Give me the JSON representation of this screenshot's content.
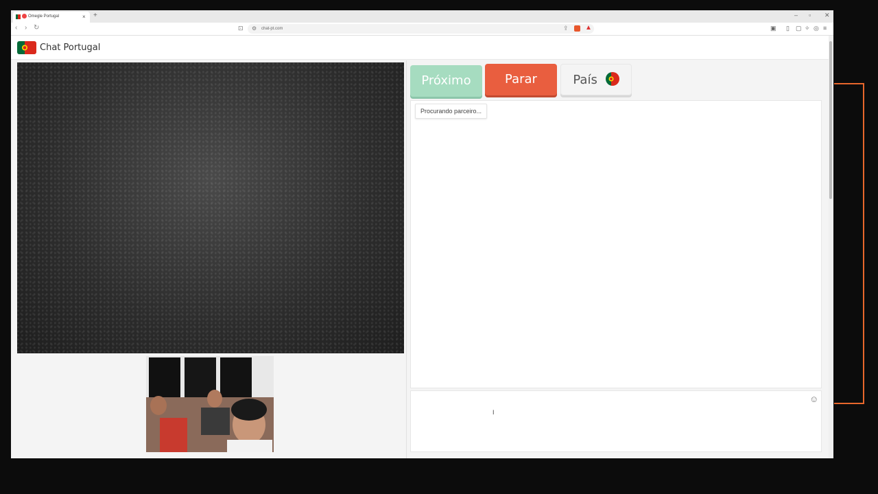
{
  "browser": {
    "tab_title": "Omegle Portugal",
    "tab_close": "×",
    "new_tab": "+",
    "window_controls": [
      "–",
      "▫",
      "✕"
    ],
    "url": "chat-pt.com",
    "nav_back": "‹",
    "nav_forward": "›",
    "reload": "↻"
  },
  "site": {
    "title": "Chat Portugal"
  },
  "controls": {
    "next_label": "Próximo",
    "stop_label": "Parar",
    "country_label": "País"
  },
  "chat": {
    "status": "Procurando parceiro...",
    "input_value": ""
  },
  "colors": {
    "next": "#a6dcc0",
    "stop": "#e95e3f",
    "accent": "#e8672c"
  }
}
